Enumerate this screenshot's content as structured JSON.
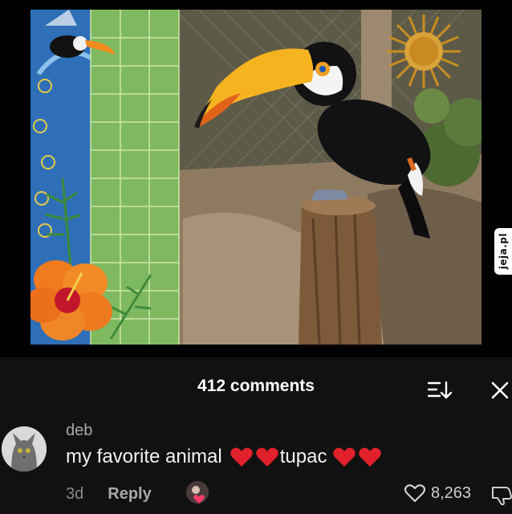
{
  "watermark": {
    "text": "jeja.pl"
  },
  "comments_panel": {
    "count_label": "412 comments",
    "sort_icon": "sort-down-icon",
    "close_icon": "close-icon"
  },
  "comment": {
    "username": "deb",
    "text_part1": "my favorite animal",
    "text_part2": "tupac",
    "emoji": "red-heart",
    "age": "3d",
    "reply_label": "Reply",
    "like_count": "8,263",
    "like_icon": "heart-outline-icon",
    "dislike_icon": "thumbs-down-icon"
  },
  "colors": {
    "panel_bg": "#111111",
    "heart_red": "#e0202a",
    "meta_gray": "#8a8a8a"
  }
}
